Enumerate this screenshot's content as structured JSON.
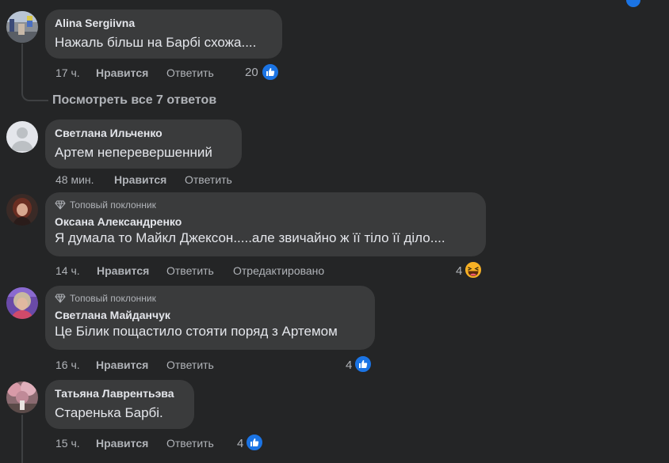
{
  "comments": [
    {
      "author": "Alina Sergiivna",
      "text": "Нажаль більш на Барбі схожа....",
      "time": "17 ч.",
      "like": "Нравится",
      "reply": "Ответить",
      "reaction_count": "20",
      "reaction": "like"
    },
    {
      "author": "Светлана Ильченко",
      "text": "Артем неперевершенний",
      "time": "48 мин.",
      "like": "Нравится",
      "reply": "Ответить"
    },
    {
      "badge": "Топовый поклонник",
      "author": "Оксана Александренко",
      "text": "Я думала то Майкл Джексон.....але звичайно ж її тіло її діло....",
      "time": "14 ч.",
      "like": "Нравится",
      "reply": "Ответить",
      "edited": "Отредактировано",
      "reaction_count": "4",
      "reaction": "haha"
    },
    {
      "badge": "Топовый поклонник",
      "author": "Светлана Майданчук",
      "text": "Це Білик пощастило стояти поряд з Артемом",
      "time": "16 ч.",
      "like": "Нравится",
      "reply": "Ответить",
      "reaction_count": "4",
      "reaction": "like"
    },
    {
      "author": "Татьяна Лаврентьэва",
      "text": "Старенька Барбі.",
      "time": "15 ч.",
      "like": "Нравится",
      "reply": "Ответить",
      "reaction_count": "4",
      "reaction": "like"
    }
  ],
  "view_replies": "Посмотреть все 7 ответов",
  "colors": {
    "background": "#242526",
    "bubble": "#3a3b3c",
    "text": "#e4e6eb",
    "secondary": "#b0b3b8",
    "like_blue": "#1b74e4"
  }
}
